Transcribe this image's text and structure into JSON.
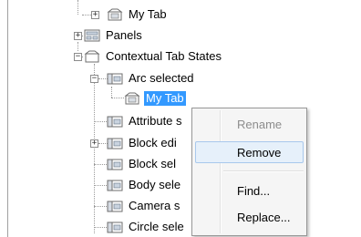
{
  "tree": {
    "nodes": [
      {
        "label": "My Tab"
      },
      {
        "label": "Panels"
      },
      {
        "label": "Contextual Tab States"
      },
      {
        "label": "Arc selected"
      },
      {
        "label": "My Tab"
      },
      {
        "label": "Attribute s"
      },
      {
        "label": "Block edi"
      },
      {
        "label": "Block sel"
      },
      {
        "label": "Body sele"
      },
      {
        "label": "Camera s"
      },
      {
        "label": "Circle sele"
      }
    ]
  },
  "context_menu": {
    "items": [
      {
        "label": "Rename",
        "enabled": false
      },
      {
        "label": "Remove",
        "enabled": true
      },
      {
        "label": "Find...",
        "enabled": true
      },
      {
        "label": "Replace...",
        "enabled": true
      }
    ]
  },
  "colors": {
    "selection": "#3399ff",
    "hover_fill": "#e6f0fa",
    "disabled_text": "#8d8d8d"
  }
}
